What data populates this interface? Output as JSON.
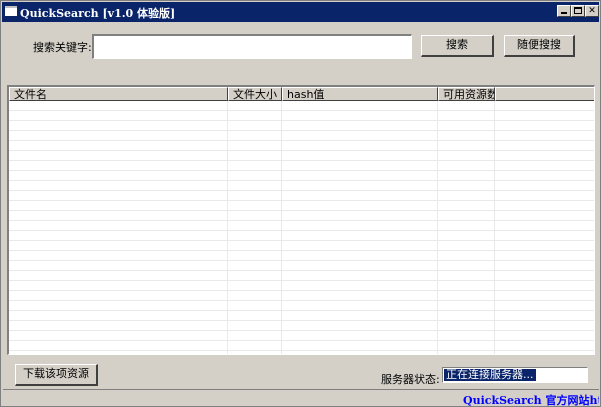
{
  "window": {
    "title": "QuickSearch [v1.0 体验版]",
    "title_bg": "#0a246a",
    "controls": [
      "minimize-icon",
      "maximize-icon",
      "close-icon"
    ]
  },
  "search": {
    "label": "搜索关键字:",
    "value": "",
    "search_button": "搜索",
    "random_button": "随便搜搜"
  },
  "results": {
    "columns": [
      "文件名",
      "文件大小",
      "hash值",
      "可用资源数"
    ],
    "rows": []
  },
  "footer": {
    "download_button": "下载该项资源",
    "status_label": "服务器状态:",
    "status_value": "正在连接服务器...",
    "site_link": "QuickSearch 官方网站http://w",
    "link_color": "#0000ff"
  }
}
